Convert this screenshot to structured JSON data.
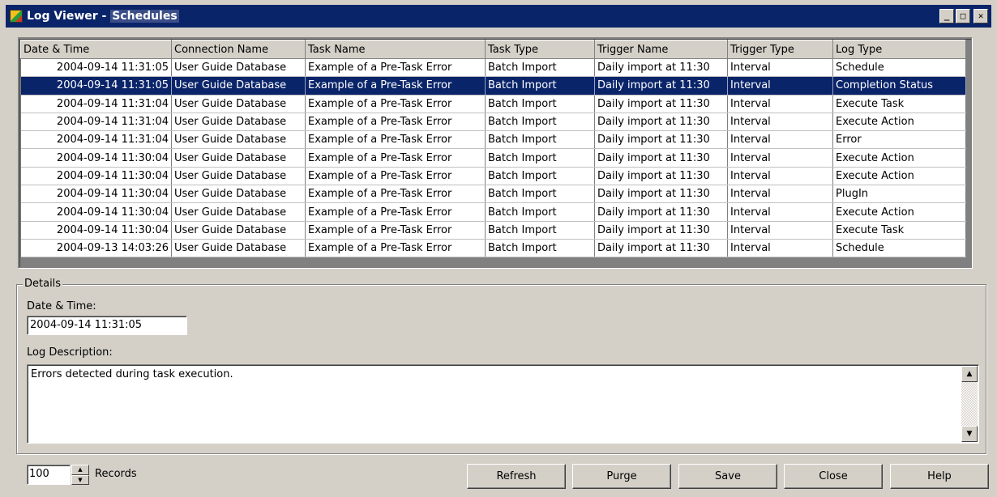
{
  "window": {
    "title_prefix": "Log Viewer - ",
    "title_highlight": "Schedules",
    "minimize": "_",
    "maximize": "□",
    "close": "✕"
  },
  "table": {
    "columns": [
      "Date & Time",
      "Connection Name",
      "Task Name",
      "Task Type",
      "Trigger Name",
      "Trigger Type",
      "Log Type"
    ],
    "rows": [
      [
        "2004-09-14 11:31:05",
        "User Guide Database",
        "Example of a Pre-Task Error",
        "Batch Import",
        "Daily import at 11:30",
        "Interval",
        "Schedule"
      ],
      [
        "2004-09-14 11:31:05",
        "User Guide Database",
        "Example of a Pre-Task Error",
        "Batch Import",
        "Daily import at 11:30",
        "Interval",
        "Completion Status"
      ],
      [
        "2004-09-14 11:31:04",
        "User Guide Database",
        "Example of a Pre-Task Error",
        "Batch Import",
        "Daily import at 11:30",
        "Interval",
        "Execute Task"
      ],
      [
        "2004-09-14 11:31:04",
        "User Guide Database",
        "Example of a Pre-Task Error",
        "Batch Import",
        "Daily import at 11:30",
        "Interval",
        "Execute Action"
      ],
      [
        "2004-09-14 11:31:04",
        "User Guide Database",
        "Example of a Pre-Task Error",
        "Batch Import",
        "Daily import at 11:30",
        "Interval",
        "Error"
      ],
      [
        "2004-09-14 11:30:04",
        "User Guide Database",
        "Example of a Pre-Task Error",
        "Batch Import",
        "Daily import at 11:30",
        "Interval",
        "Execute Action"
      ],
      [
        "2004-09-14 11:30:04",
        "User Guide Database",
        "Example of a Pre-Task Error",
        "Batch Import",
        "Daily import at 11:30",
        "Interval",
        "Execute Action"
      ],
      [
        "2004-09-14 11:30:04",
        "User Guide Database",
        "Example of a Pre-Task Error",
        "Batch Import",
        "Daily import at 11:30",
        "Interval",
        "PlugIn"
      ],
      [
        "2004-09-14 11:30:04",
        "User Guide Database",
        "Example of a Pre-Task Error",
        "Batch Import",
        "Daily import at 11:30",
        "Interval",
        "Execute Action"
      ],
      [
        "2004-09-14 11:30:04",
        "User Guide Database",
        "Example of a Pre-Task Error",
        "Batch Import",
        "Daily import at 11:30",
        "Interval",
        "Execute Task"
      ],
      [
        "2004-09-13 14:03:26",
        "User Guide Database",
        "Example of a Pre-Task Error",
        "Batch Import",
        "Daily import at 11:30",
        "Interval",
        "Schedule"
      ]
    ],
    "selected_row": 1
  },
  "details": {
    "group_title": "Details",
    "datetime_label": "Date & Time:",
    "datetime_value": "2004-09-14 11:31:05",
    "description_label": "Log Description:",
    "description_value": "Errors detected during task execution."
  },
  "footer": {
    "records_value": "100",
    "records_label": "Records",
    "buttons": {
      "refresh": "Refresh",
      "purge": "Purge",
      "save": "Save",
      "close": "Close",
      "help": "Help"
    }
  },
  "colors": {
    "titlebar": "#0a246a",
    "selection": "#0a246a",
    "face": "#d4d0c8"
  }
}
